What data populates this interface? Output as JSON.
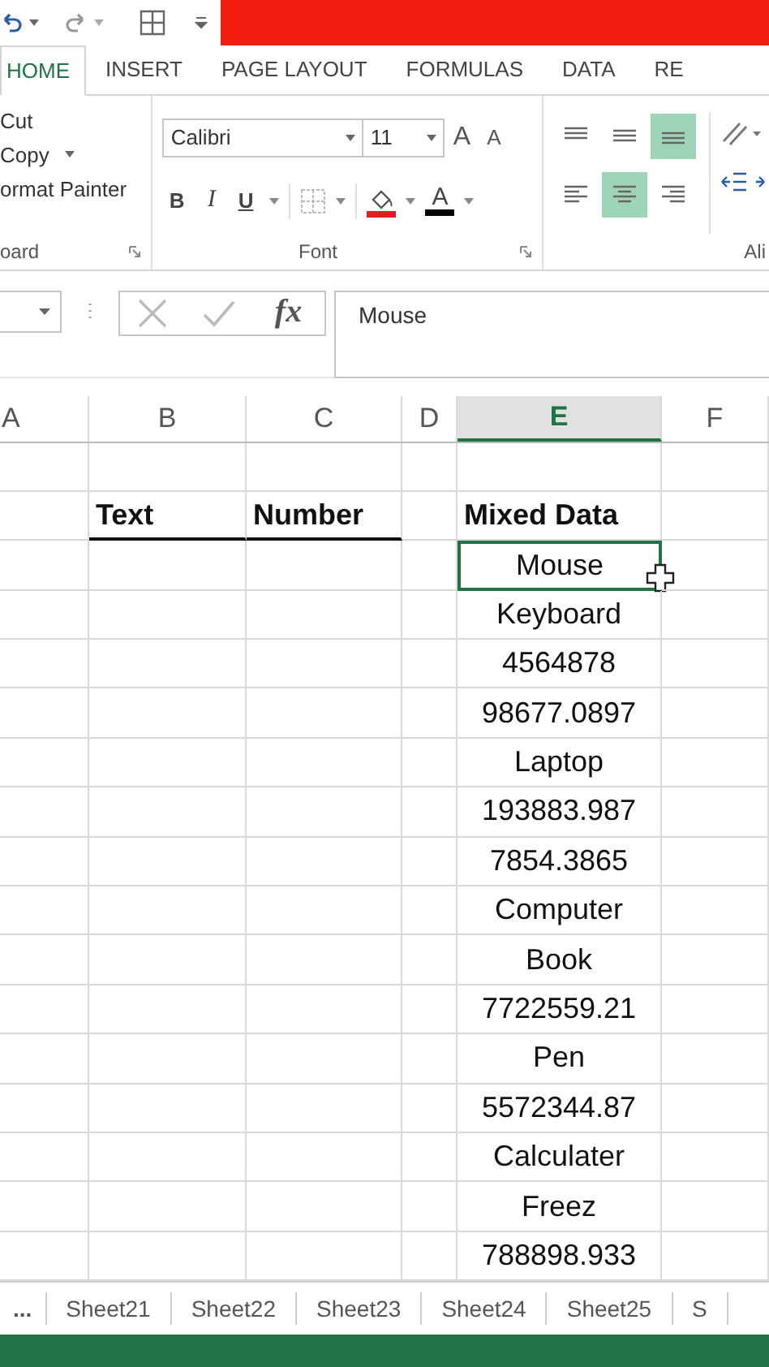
{
  "tabs": [
    {
      "label": "HOME",
      "selected": true
    },
    {
      "label": "INSERT",
      "selected": false
    },
    {
      "label": "PAGE LAYOUT",
      "selected": false
    },
    {
      "label": "FORMULAS",
      "selected": false
    },
    {
      "label": "DATA",
      "selected": false
    },
    {
      "label": "RE",
      "selected": false
    }
  ],
  "clipboard": {
    "items": [
      "Cut",
      "Copy",
      "ormat Painter"
    ],
    "group_label": "oard"
  },
  "font": {
    "name": "Calibri",
    "size": "11",
    "grow": "A",
    "shrink": "A",
    "format_buttons": [
      "B",
      "I",
      "U"
    ],
    "font_color": "A",
    "group_label": "Font"
  },
  "alignment": {
    "buttons": [
      {
        "kind": "top",
        "selected": false
      },
      {
        "kind": "middle",
        "selected": false
      },
      {
        "kind": "bottom",
        "selected": true
      },
      {
        "kind": "left",
        "selected": false
      },
      {
        "kind": "center",
        "selected": true
      },
      {
        "kind": "right",
        "selected": false
      }
    ],
    "group_label": "Ali"
  },
  "formula_bar": {
    "fx": "fx",
    "value": "Mouse"
  },
  "columns": [
    {
      "label": "A",
      "selected": false
    },
    {
      "label": "B",
      "selected": false
    },
    {
      "label": "C",
      "selected": false
    },
    {
      "label": "D",
      "selected": false
    },
    {
      "label": "E",
      "selected": true
    },
    {
      "label": "F",
      "selected": false
    }
  ],
  "headers": [
    "Text",
    "Number",
    "Mixed Data"
  ],
  "mixed_data": [
    {
      "value": "Mouse",
      "selected": true
    },
    {
      "value": "Keyboard",
      "selected": false
    },
    {
      "value": "4564878",
      "selected": false
    },
    {
      "value": "98677.0897",
      "selected": false
    },
    {
      "value": "Laptop",
      "selected": false
    },
    {
      "value": "193883.987",
      "selected": false
    },
    {
      "value": "7854.3865",
      "selected": false
    },
    {
      "value": "Computer",
      "selected": false
    },
    {
      "value": "Book",
      "selected": false
    },
    {
      "value": "7722559.21",
      "selected": false
    },
    {
      "value": "Pen",
      "selected": false
    },
    {
      "value": "5572344.87",
      "selected": false
    },
    {
      "value": "Calculater",
      "selected": false
    },
    {
      "value": "Freez",
      "selected": false
    },
    {
      "value": "788898.933",
      "selected": false
    }
  ],
  "sheet_tabs": [
    "...",
    "Sheet21",
    "Sheet22",
    "Sheet23",
    "Sheet24",
    "Sheet25",
    "S"
  ]
}
